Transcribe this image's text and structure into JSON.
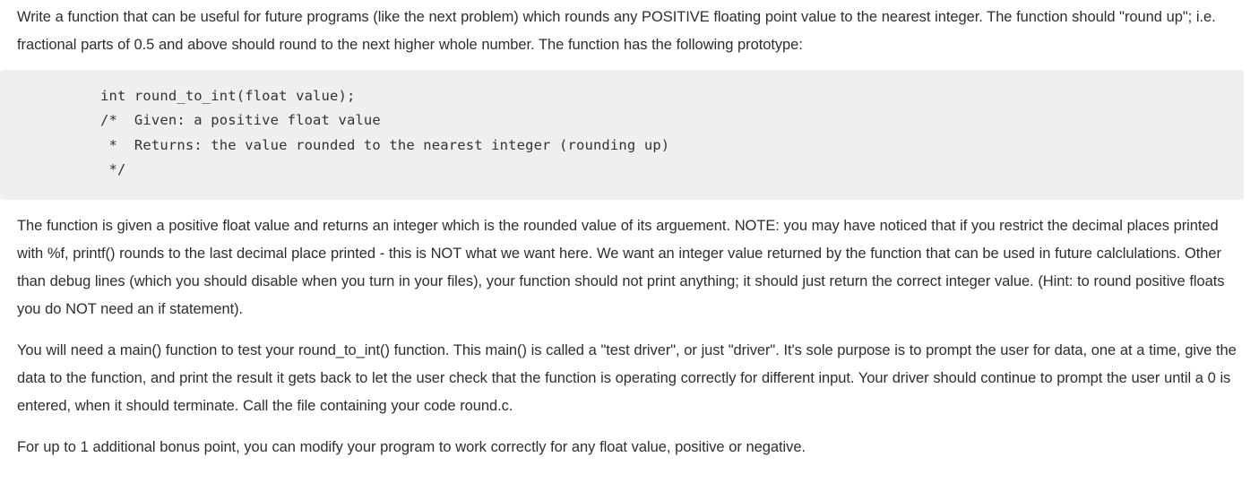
{
  "document": {
    "paragraphs": [
      {
        "id": "intro",
        "text": "Write a function that can be useful for future programs (like the next problem) which rounds any POSITIVE floating point value to the nearest integer. The function should \"round up\"; i.e. fractional parts of 0.5 and above should round to the next higher whole number. The function has the following prototype:"
      },
      {
        "id": "description",
        "text": "The function is given a positive float value and returns an integer which is the rounded value of its arguement. NOTE: you may have noticed that if you restrict the decimal places printed with %f, printf() rounds to the last decimal place printed - this is NOT what we want here. We want an integer value returned by the function that can be used in future calclulations. Other than debug lines (which you should disable when you turn in your files), your function should not print anything; it should just return the correct integer value. (Hint: to round positive floats you do NOT need an if statement)."
      },
      {
        "id": "driver",
        "text": "You will need a main() function to test your round_to_int() function. This main() is called a \"test driver\", or just \"driver\". It's sole purpose is to prompt the user for data, one at a time, give the data to the function, and print the result it gets back to let the user check that the function is operating correctly for different input. Your driver should continue to prompt the user until a 0 is entered, when it should terminate. Call the file containing your code round.c."
      },
      {
        "id": "bonus",
        "text": "For up to 1 additional bonus point, you can modify your program to work correctly for any float value, positive or negative."
      }
    ],
    "code_block": {
      "language": "c",
      "background_color": "#efefef",
      "lines": [
        "int round_to_int(float value);",
        "/*  Given: a positive float value",
        " *  Returns: the value rounded to the nearest integer (rounding up)",
        " */"
      ],
      "full_text": "int round_to_int(float value);\n/*  Given: a positive float value\n *  Returns: the value rounded to the nearest integer (rounding up)\n */"
    }
  }
}
